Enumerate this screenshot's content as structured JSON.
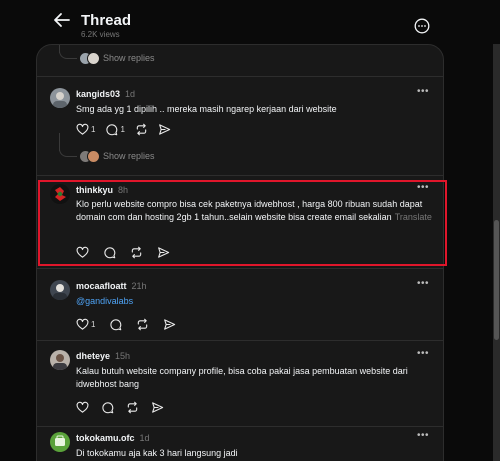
{
  "header": {
    "title": "Thread",
    "views": "6.2K views"
  },
  "show_replies_label": "Show replies",
  "translate_label": "Translate",
  "posts": [
    {
      "username": "kangids03",
      "time": "1d",
      "text": "Smg ada yg 1 dipilih .. mereka masih ngarep kerjaan dari website",
      "likes": "1",
      "comments": "1"
    },
    {
      "username": "thinkkyu",
      "time": "8h",
      "text": "Klo perlu website compro bisa cek paketnya idwebhost , harga 800 ribuan sudah dapat domain com dan hosting 2gb 1 tahun..selain website bisa create email sekalian"
    },
    {
      "username": "mocaafloatt",
      "time": "21h",
      "text": "@gandivalabs",
      "likes": "1"
    },
    {
      "username": "dheteye",
      "time": "15h",
      "text": "Kalau butuh website company profile, bisa coba pakai jasa pembuatan website dari idwebhost bang"
    },
    {
      "username": "tokokamu.ofc",
      "time": "1d",
      "text": "Di tokokamu aja kak 3 hari langsung jadi"
    }
  ],
  "colors": {
    "background": "#0a0a0a",
    "panel": "#181818",
    "link": "#4ea3f5",
    "highlight_box": "#e0162b"
  },
  "icons": [
    "back-arrow-icon",
    "more-options-icon",
    "heart-icon",
    "comment-icon",
    "repost-icon",
    "share-icon"
  ]
}
